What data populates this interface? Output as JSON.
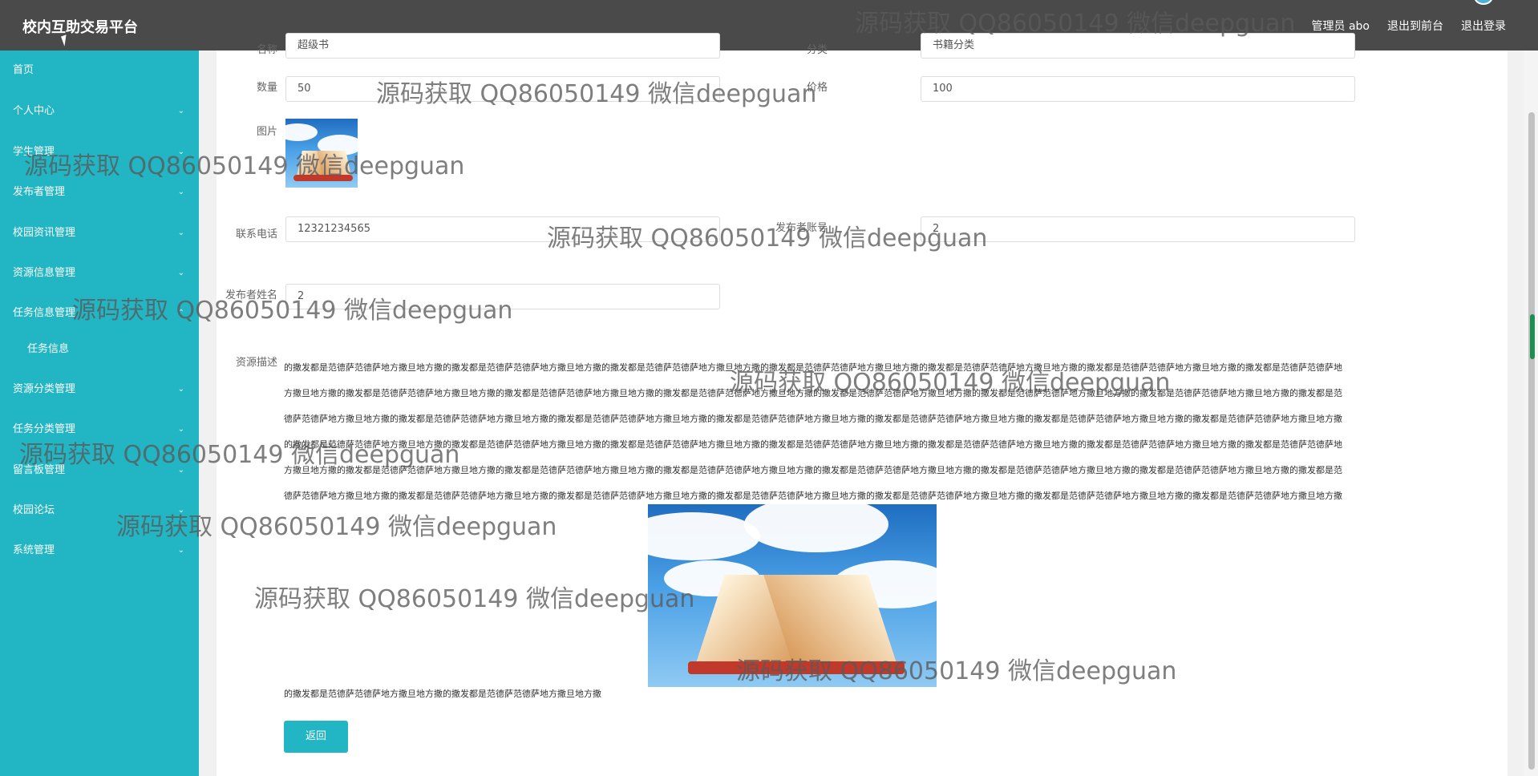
{
  "header": {
    "title": "校内互助交易平台",
    "user_label": "管理员 abo",
    "to_front_label": "退出到前台",
    "logout_label": "退出登录"
  },
  "sidebar": {
    "items": [
      {
        "label": "首页"
      },
      {
        "label": "个人中心"
      },
      {
        "label": "学生管理"
      },
      {
        "label": "发布者管理"
      },
      {
        "label": "校园资讯管理"
      },
      {
        "label": "资源信息管理"
      },
      {
        "label": "任务信息管理"
      },
      {
        "label": "任务信息"
      },
      {
        "label": "资源分类管理"
      },
      {
        "label": "任务分类管理"
      },
      {
        "label": "留言板管理"
      },
      {
        "label": "校园论坛"
      },
      {
        "label": "系统管理"
      }
    ]
  },
  "form": {
    "top_left_label": "名称",
    "top_left_value": "超级书",
    "top_right_label": "分类",
    "top_right_value": "书籍分类",
    "quantity_label": "数量",
    "quantity_value": "50",
    "price_label": "价格",
    "price_value": "100",
    "image_label": "图片",
    "phone_label": "联系电话",
    "phone_value": "12321234565",
    "publisher_account_label": "发布者账号",
    "publisher_account_value": "2",
    "publisher_name_label": "发布者姓名",
    "publisher_name_value": "2",
    "description_label": "资源描述",
    "description_lines": [
      "的撒发都是范德萨范德萨地方撒旦地方撒的撒发都是范德萨范德萨地方撒旦地方撒的撒发都是范德萨范德萨地方撒旦地方撒的撒发都是范德萨范德萨地方撒旦地方撒的撒发都是范德萨范德萨地方撒旦地方撒的撒发都是范德萨范德萨地方撒旦地方撒的撒发都是范德萨范德萨地",
      "方撒旦地方撒的撒发都是范德萨范德萨地方撒旦地方撒的撒发都是范德萨范德萨地方撒旦地方撒的撒发都是范德萨范德萨地方撒旦地方撒的撒发都是范德萨范德萨地方撒旦地方撒的撒发都是范德萨范德萨地方撒旦地方撒的撒发都是范德萨范德萨地方撒旦地方撒的撒发都是范",
      "德萨范德萨地方撒旦地方撒的撒发都是范德萨范德萨地方撒旦地方撒的撒发都是范德萨范德萨地方撒旦地方撒的撒发都是范德萨范德萨地方撒旦地方撒的撒发都是范德萨范德萨地方撒旦地方撒的撒发都是范德萨范德萨地方撒旦地方撒的撒发都是范德萨范德萨地方撒旦地方撒",
      "的撒发都是范德萨范德萨地方撒旦地方撒的撒发都是范德萨范德萨地方撒旦地方撒的撒发都是范德萨范德萨地方撒旦地方撒的撒发都是范德萨范德萨地方撒旦地方撒的撒发都是范德萨范德萨地方撒旦地方撒的撒发都是范德萨范德萨地方撒旦地方撒的撒发都是范德萨范德萨地",
      "方撒旦地方撒的撒发都是范德萨范德萨地方撒旦地方撒的撒发都是范德萨范德萨地方撒旦地方撒的撒发都是范德萨范德萨地方撒旦地方撒的撒发都是范德萨范德萨地方撒旦地方撒的撒发都是范德萨范德萨地方撒旦地方撒的撒发都是范德萨范德萨地方撒旦地方撒的撒发都是范",
      "德萨范德萨地方撒旦地方撒的撒发都是范德萨范德萨地方撒旦地方撒的撒发都是范德萨范德萨地方撒旦地方撒的撒发都是范德萨范德萨地方撒旦地方撒的撒发都是范德萨范德萨地方撒旦地方撒的撒发都是范德萨范德萨地方撒旦地方撒的撒发都是范德萨范德萨地方撒旦地方撒"
    ],
    "description_tail": "的撒发都是范德萨范德萨地方撒旦地方撒的撒发都是范德萨范德萨地方撒旦地方撒",
    "back_label": "返回"
  },
  "watermark": "源码获取 QQ86050149 微信deepguan"
}
